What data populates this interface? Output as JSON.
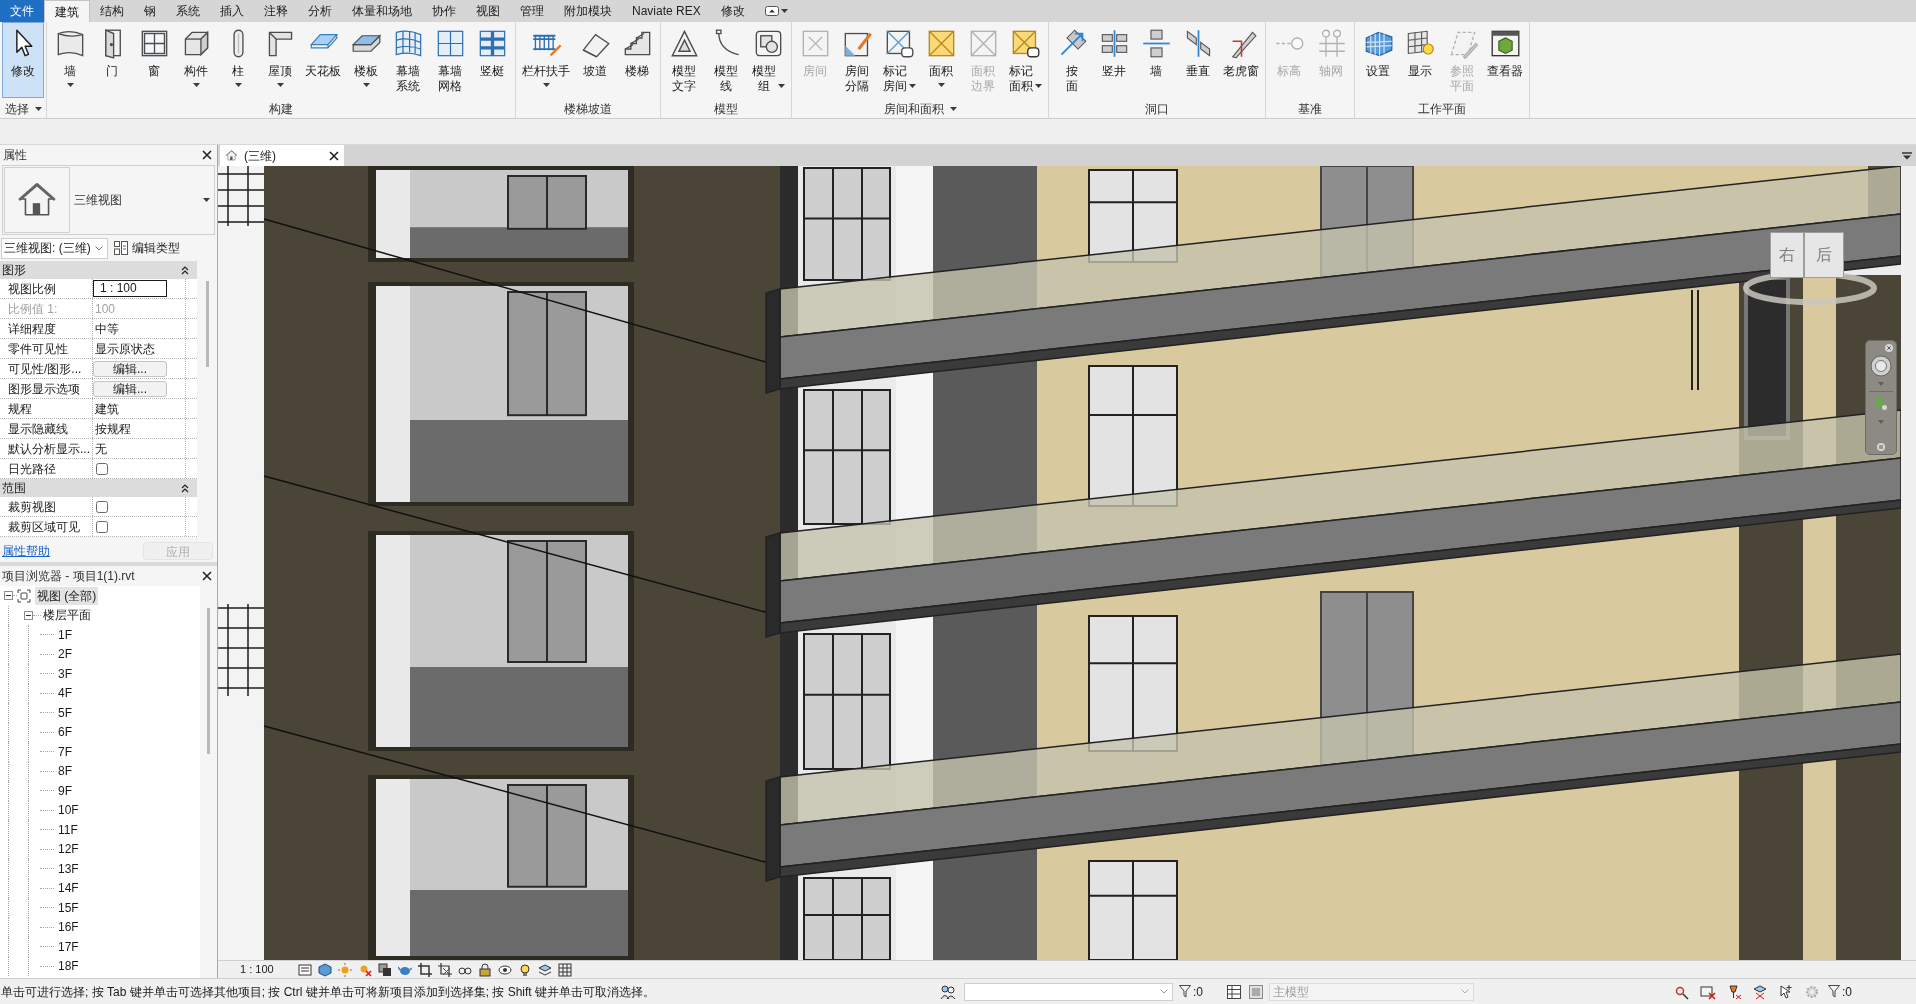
{
  "ribbon_tabs": [
    {
      "label": "文件",
      "kind": "app_menu",
      "selected": false
    },
    {
      "label": "建筑",
      "kind": "tab",
      "selected": true
    },
    {
      "label": "结构",
      "kind": "tab",
      "selected": false
    },
    {
      "label": "钢",
      "kind": "tab",
      "selected": false
    },
    {
      "label": "系统",
      "kind": "tab",
      "selected": false
    },
    {
      "label": "插入",
      "kind": "tab",
      "selected": false
    },
    {
      "label": "注释",
      "kind": "tab",
      "selected": false
    },
    {
      "label": "分析",
      "kind": "tab",
      "selected": false
    },
    {
      "label": "体量和场地",
      "kind": "tab",
      "selected": false
    },
    {
      "label": "协作",
      "kind": "tab",
      "selected": false
    },
    {
      "label": "视图",
      "kind": "tab",
      "selected": false
    },
    {
      "label": "管理",
      "kind": "tab",
      "selected": false
    },
    {
      "label": "附加模块",
      "kind": "tab",
      "selected": false
    },
    {
      "label": "Naviate REX",
      "kind": "tab",
      "selected": false
    },
    {
      "label": "修改",
      "kind": "tab",
      "selected": false
    }
  ],
  "ribbon_panels": [
    {
      "title": "选择",
      "dropdown": true,
      "buttons": [
        {
          "label": "修改",
          "kind": "one_line",
          "selected": true,
          "disabled": false,
          "dropdown": false
        }
      ]
    },
    {
      "title": "构建",
      "dropdown": false,
      "buttons": [
        {
          "label": "墙",
          "kind": "one_line",
          "selected": false,
          "disabled": false,
          "dropdown": true
        },
        {
          "label": "门",
          "kind": "one_line",
          "selected": false,
          "disabled": false,
          "dropdown": false
        },
        {
          "label": "窗",
          "kind": "one_line",
          "selected": false,
          "disabled": false,
          "dropdown": false
        },
        {
          "label": "构件",
          "kind": "one_line",
          "selected": false,
          "disabled": false,
          "dropdown": true
        },
        {
          "label": "柱",
          "kind": "one_line",
          "selected": false,
          "disabled": false,
          "dropdown": true
        },
        {
          "label": "屋顶",
          "kind": "one_line",
          "selected": false,
          "disabled": false,
          "dropdown": true
        },
        {
          "label": "天花板",
          "kind": "one_line",
          "selected": false,
          "disabled": false,
          "dropdown": false
        },
        {
          "label": "楼板",
          "kind": "one_line",
          "selected": false,
          "disabled": false,
          "dropdown": true
        },
        {
          "label": "幕墙系统",
          "kind": "two_lines",
          "selected": false,
          "disabled": false,
          "dropdown": false
        },
        {
          "label": "幕墙网格",
          "kind": "two_lines",
          "selected": false,
          "disabled": false,
          "dropdown": false
        },
        {
          "label": "竖梃",
          "kind": "one_line",
          "selected": false,
          "disabled": false,
          "dropdown": false
        }
      ]
    },
    {
      "title": "楼梯坡道",
      "dropdown": false,
      "buttons": [
        {
          "label": "栏杆扶手",
          "kind": "one_line",
          "selected": false,
          "disabled": false,
          "dropdown": true
        },
        {
          "label": "坡道",
          "kind": "one_line",
          "selected": false,
          "disabled": false,
          "dropdown": false
        },
        {
          "label": "楼梯",
          "kind": "one_line",
          "selected": false,
          "disabled": false,
          "dropdown": false
        }
      ]
    },
    {
      "title": "模型",
      "dropdown": false,
      "buttons": [
        {
          "label": "模型文字",
          "kind": "two_lines",
          "selected": false,
          "disabled": false,
          "dropdown": false
        },
        {
          "label": "模型线",
          "kind": "two_lines",
          "selected": false,
          "disabled": false,
          "dropdown": false
        },
        {
          "label": "模型组",
          "kind": "two_lines",
          "selected": false,
          "disabled": false,
          "dropdown": true
        }
      ]
    },
    {
      "title": "房间和面积",
      "dropdown": true,
      "buttons": [
        {
          "label": "房间",
          "kind": "one_line",
          "selected": false,
          "disabled": true,
          "dropdown": false
        },
        {
          "label": "房间分隔",
          "kind": "two_lines",
          "selected": false,
          "disabled": false,
          "dropdown": false
        },
        {
          "label": "标记房间",
          "kind": "two_lines",
          "selected": false,
          "disabled": false,
          "dropdown": true
        },
        {
          "label": "面积",
          "kind": "one_line",
          "selected": false,
          "disabled": false,
          "dropdown": true
        },
        {
          "label": "面积边界",
          "kind": "two_lines",
          "selected": false,
          "disabled": true,
          "dropdown": false
        },
        {
          "label": "标记面积",
          "kind": "two_lines",
          "selected": false,
          "disabled": false,
          "dropdown": true
        }
      ]
    },
    {
      "title": "洞口",
      "dropdown": false,
      "buttons": [
        {
          "label": "按面",
          "kind": "vertical",
          "selected": false,
          "disabled": false,
          "dropdown": false
        },
        {
          "label": "竖井",
          "kind": "one_line",
          "selected": false,
          "disabled": false,
          "dropdown": false
        },
        {
          "label": "墙",
          "kind": "one_line",
          "selected": false,
          "disabled": false,
          "dropdown": false
        },
        {
          "label": "垂直",
          "kind": "one_line",
          "selected": false,
          "disabled": false,
          "dropdown": false
        },
        {
          "label": "老虎窗",
          "kind": "one_line",
          "selected": false,
          "disabled": false,
          "dropdown": false
        }
      ]
    },
    {
      "title": "基准",
      "dropdown": false,
      "buttons": [
        {
          "label": "标高",
          "kind": "one_line",
          "selected": false,
          "disabled": true,
          "dropdown": false
        },
        {
          "label": "轴网",
          "kind": "one_line",
          "selected": false,
          "disabled": true,
          "dropdown": false
        }
      ]
    },
    {
      "title": "工作平面",
      "dropdown": false,
      "buttons": [
        {
          "label": "设置",
          "kind": "one_line",
          "selected": false,
          "disabled": false,
          "dropdown": false
        },
        {
          "label": "显示",
          "kind": "one_line",
          "selected": false,
          "disabled": false,
          "dropdown": false
        },
        {
          "label": "参照平面",
          "kind": "two_lines",
          "selected": false,
          "disabled": true,
          "dropdown": false
        },
        {
          "label": "查看器",
          "kind": "one_line",
          "selected": false,
          "disabled": false,
          "dropdown": false
        }
      ]
    }
  ],
  "properties": {
    "title": "属性",
    "type_name": "三维视图",
    "view_selector": "三维视图: (三维)",
    "edit_type": "编辑类型",
    "sections": [
      {
        "title": "图形",
        "expanded": true,
        "rows": [
          {
            "label": "视图比例",
            "kind": "input",
            "value": "1 : 100",
            "disabled": false
          },
          {
            "label": "比例值 1:",
            "kind": "text",
            "value": "100",
            "disabled": true
          },
          {
            "label": "详细程度",
            "kind": "text",
            "value": "中等",
            "disabled": false
          },
          {
            "label": "零件可见性",
            "kind": "text",
            "value": "显示原状态",
            "disabled": false
          },
          {
            "label": "可见性/图形...",
            "kind": "button",
            "value": "编辑...",
            "disabled": false
          },
          {
            "label": "图形显示选项",
            "kind": "button",
            "value": "编辑...",
            "disabled": false
          },
          {
            "label": "规程",
            "kind": "text",
            "value": "建筑",
            "disabled": false
          },
          {
            "label": "显示隐藏线",
            "kind": "text",
            "value": "按规程",
            "disabled": false
          },
          {
            "label": "默认分析显示...",
            "kind": "text",
            "value": "无",
            "disabled": false
          },
          {
            "label": "日光路径",
            "kind": "checkbox",
            "checked": false,
            "disabled": false
          }
        ]
      },
      {
        "title": "范围",
        "expanded": true,
        "rows": [
          {
            "label": "裁剪视图",
            "kind": "checkbox",
            "checked": false,
            "disabled": false
          },
          {
            "label": "裁剪区域可见",
            "kind": "checkbox",
            "checked": false,
            "disabled": false
          }
        ]
      }
    ],
    "help_link": "属性帮助",
    "apply": {
      "label": "应用",
      "disabled": true
    }
  },
  "project_browser": {
    "title": "项目浏览器 - 项目1(1).rvt",
    "tree": [
      {
        "label": "视图 (全部)",
        "expanded": true,
        "selected": true,
        "children": [
          {
            "label": "楼层平面",
            "expanded": true,
            "selected": false,
            "children": [
              {
                "label": "1F",
                "selected": false
              },
              {
                "label": "2F",
                "selected": false
              },
              {
                "label": "3F",
                "selected": false
              },
              {
                "label": "4F",
                "selected": false
              },
              {
                "label": "5F",
                "selected": false
              },
              {
                "label": "6F",
                "selected": false
              },
              {
                "label": "7F",
                "selected": false
              },
              {
                "label": "8F",
                "selected": false
              },
              {
                "label": "9F",
                "selected": false
              },
              {
                "label": "10F",
                "selected": false
              },
              {
                "label": "11F",
                "selected": false
              },
              {
                "label": "12F",
                "selected": false
              },
              {
                "label": "13F",
                "selected": false
              },
              {
                "label": "14F",
                "selected": false
              },
              {
                "label": "15F",
                "selected": false
              },
              {
                "label": "16F",
                "selected": false
              },
              {
                "label": "17F",
                "selected": false
              },
              {
                "label": "18F",
                "selected": false
              }
            ]
          }
        ]
      }
    ]
  },
  "view_tabs": [
    {
      "label": "(三维)",
      "selected": true
    }
  ],
  "viewport": {
    "view_cube": {
      "faces": [
        "右",
        "后"
      ]
    }
  },
  "view_control_bar": {
    "scale": "1 : 100"
  },
  "status_bar": {
    "message": "单击可进行选择; 按 Tab 键并单击可选择其他项目; 按 Ctrl 键并单击可将新项目添加到选择集; 按 Shift 键并单击可取消选择。",
    "filter_count": ":0",
    "design_option": {
      "value": "主模型",
      "disabled": true
    },
    "selection_count": ":0"
  }
}
